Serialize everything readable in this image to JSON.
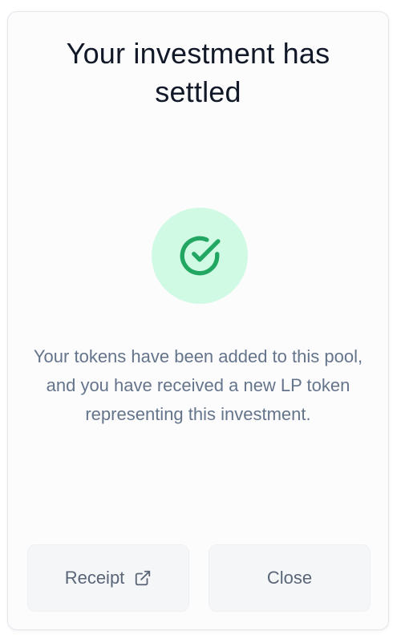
{
  "modal": {
    "title": "Your investment has settled",
    "status_icon": "check-circle-icon",
    "message": "Your tokens have been added to this pool, and you have received a new LP token representing this investment.",
    "colors": {
      "badge_bg": "#d1fae5",
      "check": "#22a763",
      "title": "#111827",
      "message": "#64748b"
    }
  },
  "actions": {
    "receipt_label": "Receipt",
    "receipt_icon": "external-link-icon",
    "close_label": "Close"
  }
}
